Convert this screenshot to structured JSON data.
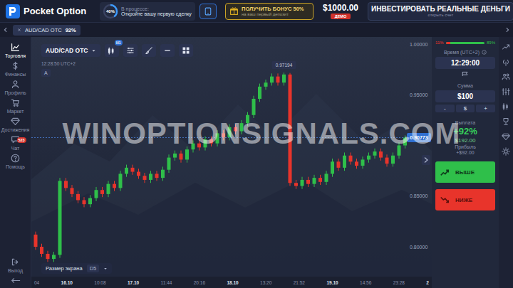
{
  "logo": {
    "text": "Pocket Option"
  },
  "progress": {
    "percent": "40%",
    "level": 0.4,
    "label": "В процессе:",
    "task": "Откройте вашу первую сделку"
  },
  "bonus": {
    "title": "ПОЛУЧИТЬ БОНУС 50%",
    "subtitle": "на ваш первый депозит"
  },
  "balance": {
    "amount": "$1000.00",
    "badge": "ДЕМО"
  },
  "invest": {
    "title": "ИНВЕСТИРОВАТЬ РЕАЛЬНЫЕ ДЕНЬГИ",
    "subtitle": "открыть счет"
  },
  "tabs": [
    {
      "label": "AUD/CAD OTC",
      "payout": "92%",
      "selected": true
    }
  ],
  "sidebar": {
    "items": [
      {
        "label": "Торговля",
        "selected": true
      },
      {
        "label": "Финансы",
        "selected": false
      },
      {
        "label": "Профиль",
        "selected": false
      },
      {
        "label": "Маркет",
        "selected": false
      },
      {
        "label": "Достижения",
        "selected": false
      },
      {
        "label": "Чат",
        "selected": false,
        "badge": "523"
      },
      {
        "label": "Помощь",
        "selected": false
      }
    ],
    "footer": {
      "label": "Выход"
    }
  },
  "toolbar": {
    "symbol": "AUD/CAD OTC",
    "timeframe": "H1",
    "clock": "12:28:50 UTC+2",
    "autoscale": "A"
  },
  "screen_size": {
    "label": "Размер экрана",
    "value": "D5"
  },
  "watermark": "WINOPTIONSIGNALS.COM",
  "chart": {
    "y_ticks": [
      {
        "label": "1.00000",
        "value": 1.0
      },
      {
        "label": "0.95000",
        "value": 0.95
      },
      {
        "label": "0.85000",
        "value": 0.85
      },
      {
        "label": "0.80000",
        "value": 0.8
      }
    ],
    "current": {
      "label": "0.90773",
      "value": 0.90773
    },
    "max": {
      "label": "0.97194",
      "value": 0.97194
    },
    "open": [
      0.812,
      0.8,
      0.793,
      0.788,
      0.792,
      0.865,
      0.858,
      0.852,
      0.846,
      0.842,
      0.848,
      0.856,
      0.852,
      0.862,
      0.858,
      0.872,
      0.878,
      0.874,
      0.87,
      0.866,
      0.872,
      0.868,
      0.876,
      0.888,
      0.892,
      0.886,
      0.896,
      0.902,
      0.898,
      0.906,
      0.902,
      0.912,
      0.908,
      0.918,
      0.914,
      0.922,
      0.93,
      0.946,
      0.958,
      0.962,
      0.968,
      0.962,
      0.97,
      0.863,
      0.86,
      0.866,
      0.862,
      0.868,
      0.864,
      0.872,
      0.884,
      0.878,
      0.89,
      0.884,
      0.88,
      0.886,
      0.89,
      0.894,
      0.888,
      0.882,
      0.89,
      0.9
    ],
    "close": [
      0.8,
      0.793,
      0.788,
      0.792,
      0.865,
      0.858,
      0.852,
      0.846,
      0.842,
      0.848,
      0.856,
      0.852,
      0.862,
      0.858,
      0.872,
      0.878,
      0.874,
      0.87,
      0.866,
      0.872,
      0.868,
      0.876,
      0.888,
      0.892,
      0.886,
      0.896,
      0.902,
      0.898,
      0.906,
      0.902,
      0.912,
      0.908,
      0.918,
      0.914,
      0.922,
      0.93,
      0.946,
      0.958,
      0.962,
      0.968,
      0.962,
      0.97,
      0.863,
      0.86,
      0.866,
      0.862,
      0.868,
      0.864,
      0.872,
      0.884,
      0.878,
      0.89,
      0.884,
      0.88,
      0.886,
      0.89,
      0.894,
      0.888,
      0.882,
      0.89,
      0.9,
      0.9077
    ],
    "high": [
      0.815,
      0.803,
      0.796,
      0.795,
      0.868,
      0.868,
      0.861,
      0.855,
      0.849,
      0.851,
      0.859,
      0.859,
      0.865,
      0.865,
      0.875,
      0.881,
      0.881,
      0.877,
      0.873,
      0.875,
      0.875,
      0.879,
      0.891,
      0.895,
      0.895,
      0.899,
      0.905,
      0.905,
      0.909,
      0.909,
      0.915,
      0.915,
      0.921,
      0.921,
      0.925,
      0.933,
      0.949,
      0.961,
      0.965,
      0.971,
      0.971,
      0.97194,
      0.9715,
      0.866,
      0.869,
      0.869,
      0.871,
      0.871,
      0.875,
      0.887,
      0.887,
      0.893,
      0.893,
      0.887,
      0.889,
      0.893,
      0.897,
      0.897,
      0.891,
      0.893,
      0.903,
      0.91
    ],
    "low": [
      0.797,
      0.79,
      0.785,
      0.785,
      0.789,
      0.855,
      0.849,
      0.843,
      0.839,
      0.839,
      0.845,
      0.849,
      0.849,
      0.855,
      0.855,
      0.869,
      0.871,
      0.867,
      0.863,
      0.863,
      0.865,
      0.865,
      0.873,
      0.885,
      0.883,
      0.883,
      0.893,
      0.895,
      0.895,
      0.899,
      0.899,
      0.905,
      0.905,
      0.911,
      0.911,
      0.919,
      0.927,
      0.943,
      0.955,
      0.959,
      0.959,
      0.959,
      0.86,
      0.857,
      0.857,
      0.859,
      0.859,
      0.861,
      0.861,
      0.869,
      0.875,
      0.875,
      0.881,
      0.877,
      0.877,
      0.883,
      0.887,
      0.885,
      0.879,
      0.879,
      0.887,
      0.897
    ],
    "x_labels": [
      {
        "label": "04",
        "kind": "time"
      },
      {
        "label": "16.10",
        "kind": "date"
      },
      {
        "label": "10:08",
        "kind": "time"
      },
      {
        "label": "17.10",
        "kind": "date"
      },
      {
        "label": "11:44",
        "kind": "time"
      },
      {
        "label": "20:16",
        "kind": "time"
      },
      {
        "label": "18.10",
        "kind": "date"
      },
      {
        "label": "13:20",
        "kind": "time"
      },
      {
        "label": "21:52",
        "kind": "time"
      },
      {
        "label": "19.10",
        "kind": "date"
      },
      {
        "label": "14:56",
        "kind": "time"
      },
      {
        "label": "23:28",
        "kind": "time"
      },
      {
        "label": "2",
        "kind": "date"
      }
    ]
  },
  "sentiment": {
    "down": "11%",
    "up": "89%",
    "level": 0.11
  },
  "time": {
    "label": "Время (UTC+2)",
    "value": "12:29:00"
  },
  "amount": {
    "label": "Сумма",
    "value": "$100",
    "controls": [
      "-",
      "$",
      "+"
    ]
  },
  "payout": {
    "label": "Выплата",
    "percent": "+92%",
    "amount": "$192.00",
    "profit_label": "Прибыль",
    "profit": "+$92.00"
  },
  "trade_buttons": [
    {
      "label": "ВЫШЕ",
      "kind": "up",
      "color": "#2fbf4a"
    },
    {
      "label": "НИЖЕ",
      "kind": "down",
      "color": "#e8342b"
    }
  ]
}
